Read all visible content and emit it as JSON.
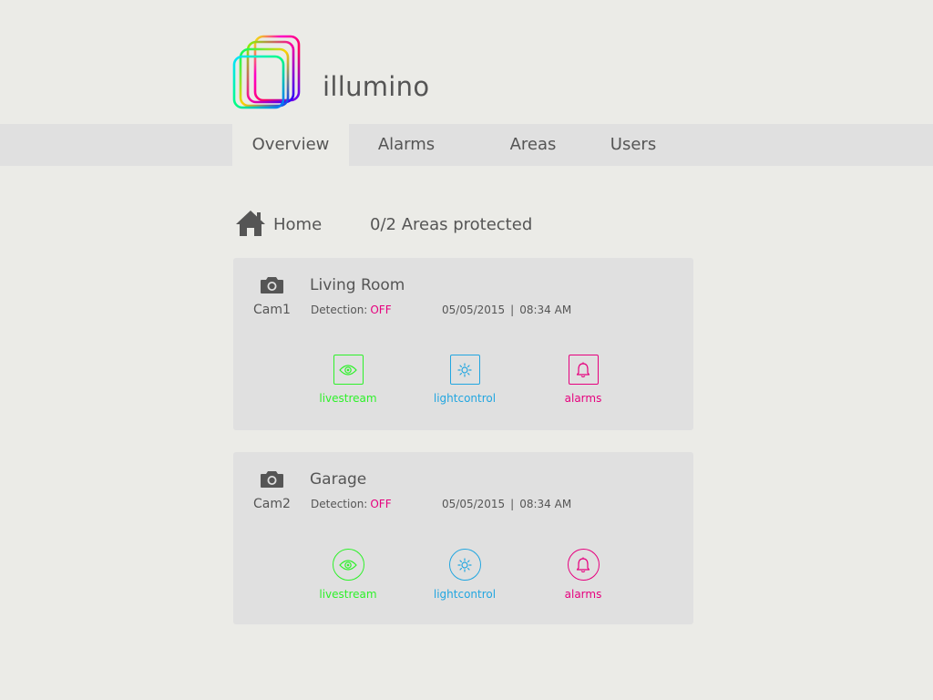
{
  "brand": {
    "name": "illumino"
  },
  "nav": {
    "tabs": [
      "Overview",
      "Alarms",
      "Areas",
      "Users"
    ],
    "active": "Overview"
  },
  "summary": {
    "home_label": "Home",
    "areas_status": "0/2 Areas protected"
  },
  "cards": [
    {
      "room": "Living Room",
      "cam": "Cam1",
      "detection_label": "Detection:",
      "detection_value": "OFF",
      "date": "05/05/2015",
      "time": "08:34 AM",
      "separator": "|",
      "actions": {
        "livestream": "livestream",
        "lightcontrol": "lightcontrol",
        "alarms": "alarms"
      }
    },
    {
      "room": "Garage",
      "cam": "Cam2",
      "detection_label": "Detection:",
      "detection_value": "OFF",
      "date": "05/05/2015",
      "time": "08:34 AM",
      "separator": "|",
      "actions": {
        "livestream": "livestream",
        "lightcontrol": "lightcontrol",
        "alarms": "alarms"
      }
    }
  ],
  "colors": {
    "livestream": "#2ef12a",
    "lightcontrol": "#22a6e0",
    "alarms": "#e6007e",
    "detection_off": "#e6007e"
  },
  "icons": {
    "logo": "rainbow-squares-logo",
    "home": "house-icon",
    "camera": "camera-icon",
    "livestream": "eye-icon",
    "lightcontrol": "sun-icon",
    "alarms": "bell-icon"
  }
}
